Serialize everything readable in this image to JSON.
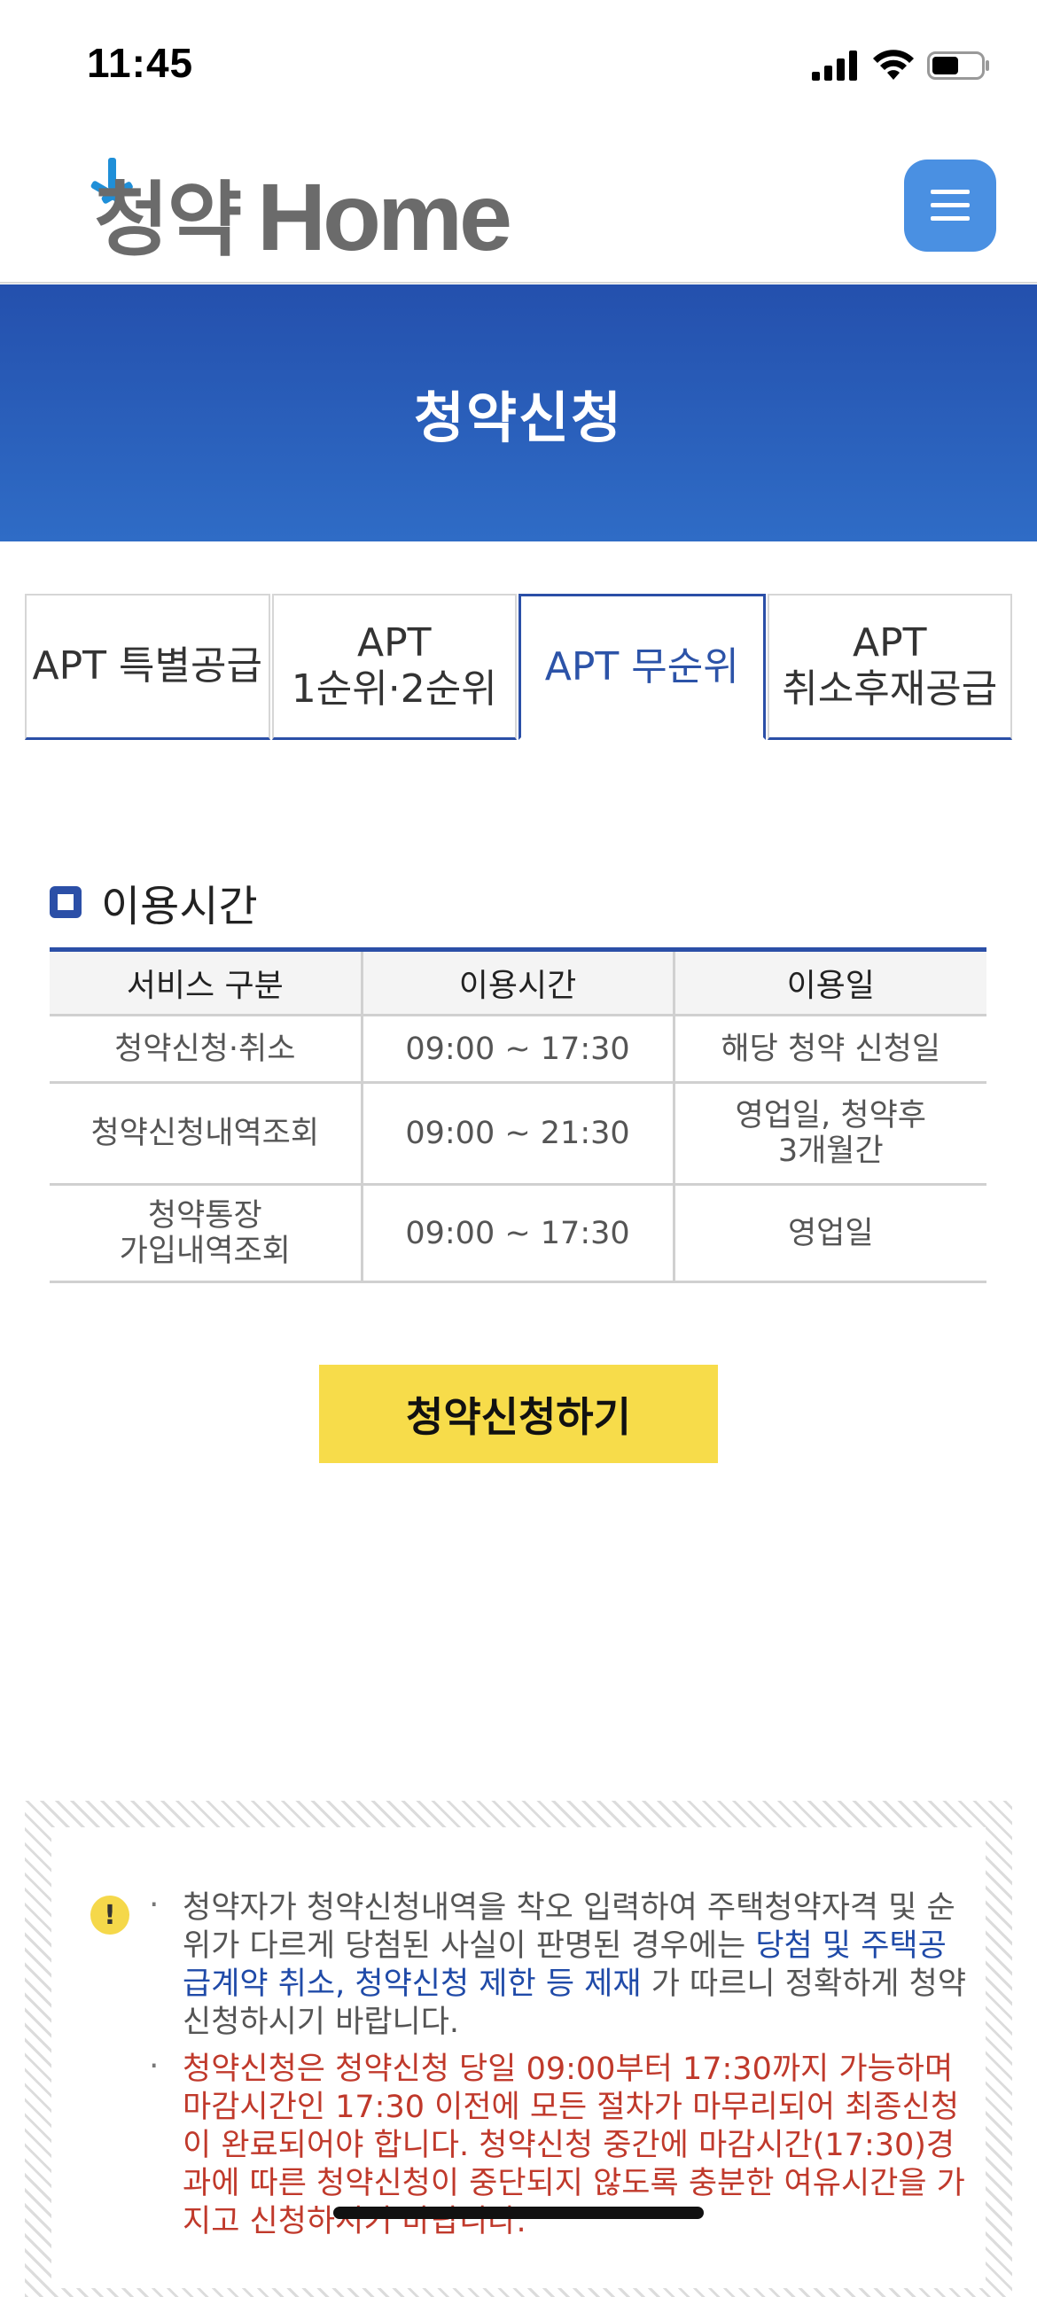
{
  "status_bar": {
    "time": "11:45",
    "battery_level": 0.55
  },
  "header": {
    "logo_text": "청약Home",
    "menu_icon": "hamburger-menu-icon",
    "brand_colors": {
      "logo_blue": "#1f8fd8",
      "logo_gray": "#6b6b6b",
      "menu_button": "#4a90e2"
    }
  },
  "banner": {
    "title": "청약신청",
    "color": "#2a5cb8"
  },
  "tabs": [
    {
      "label": "APT 특별공급",
      "active": false
    },
    {
      "label": "APT\n1순위·2순위",
      "active": false
    },
    {
      "label": "APT 무순위",
      "active": true
    },
    {
      "label": "APT\n취소후재공급",
      "active": false
    }
  ],
  "section": {
    "title": "이용시간"
  },
  "usage_table": {
    "headers": [
      "서비스 구분",
      "이용시간",
      "이용일"
    ],
    "rows": [
      [
        "청약신청·취소",
        "09:00 ~ 17:30",
        "해당 청약 신청일"
      ],
      [
        "청약신청내역조회",
        "09:00 ~ 21:30",
        "영업일, 청약후\n3개월간"
      ],
      [
        "청약통장\n가입내역조회",
        "09:00 ~ 17:30",
        "영업일"
      ]
    ]
  },
  "apply_button": {
    "label": "청약신청하기",
    "color": "#f7dc4a"
  },
  "notice": {
    "icon": "exclamation-icon",
    "item1": {
      "part1": "청약자가 청약신청내역을 착오 입력하여 주택청약자격 및 순위가 다르게 당첨된 사실이 판명된 경우에는 ",
      "highlight": "당첨 및 주택공급계약 취소, 청약신청 제한 등 제재",
      "part2": " 가 따르니 정확하게 청약 신청하시기 바랍니다."
    },
    "item2": "청약신청은 청약신청 당일 09:00부터 17:30까지 가능하며 마감시간인 17:30 이전에 모든 절차가 마무리되어 최종신청이 완료되어야 합니다. 청약신청 중간에 마감시간(17:30)경과에 따른 청약신청이 중단되지 않도록 충분한 여유시간을 가지고 신청하시기 바랍니다.",
    "colors": {
      "warning": "#c0392b",
      "highlight": "#1f4aa8"
    }
  }
}
